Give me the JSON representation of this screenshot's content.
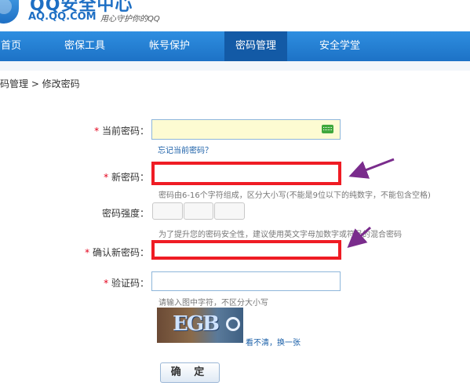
{
  "header": {
    "title": "QQ安全中心",
    "domain": "AQ.QQ.COM",
    "slogan": "用心守护你的QQ"
  },
  "nav": {
    "items": [
      {
        "label": "首页"
      },
      {
        "label": "密保工具"
      },
      {
        "label": "帐号保护"
      },
      {
        "label": "密码管理"
      },
      {
        "label": "安全学堂"
      }
    ],
    "active": "密码管理"
  },
  "breadcrumb": "码管理 > 修改密码",
  "form": {
    "required_mark": "*",
    "current_password": {
      "label": "当前密码：",
      "forgot_link": "忘记当前密码？"
    },
    "new_password": {
      "label": "新密码：",
      "hint": "密码由6-16个字符组成，区分大小写(不能是9位以下的纯数字，不能包含空格)"
    },
    "strength": {
      "label": "密码强度：",
      "segments": 3
    },
    "strength_hint": "为了提升您的密码安全性，建议使用英文字母加数字或符号的混合密码",
    "confirm_password": {
      "label": "确认新密码："
    },
    "captcha": {
      "label": "验证码：",
      "hint": "请输入图中字符，不区分大小写",
      "image_text": "EGB",
      "refresh_link": "看不清，换一张"
    },
    "submit_label": "确 定"
  },
  "colors": {
    "nav_bg": "#1d72c6",
    "nav_active": "#135aa6",
    "highlight_red": "#ef1c24",
    "annotation_arrow": "#7a2c8c",
    "required": "#e3001b"
  }
}
